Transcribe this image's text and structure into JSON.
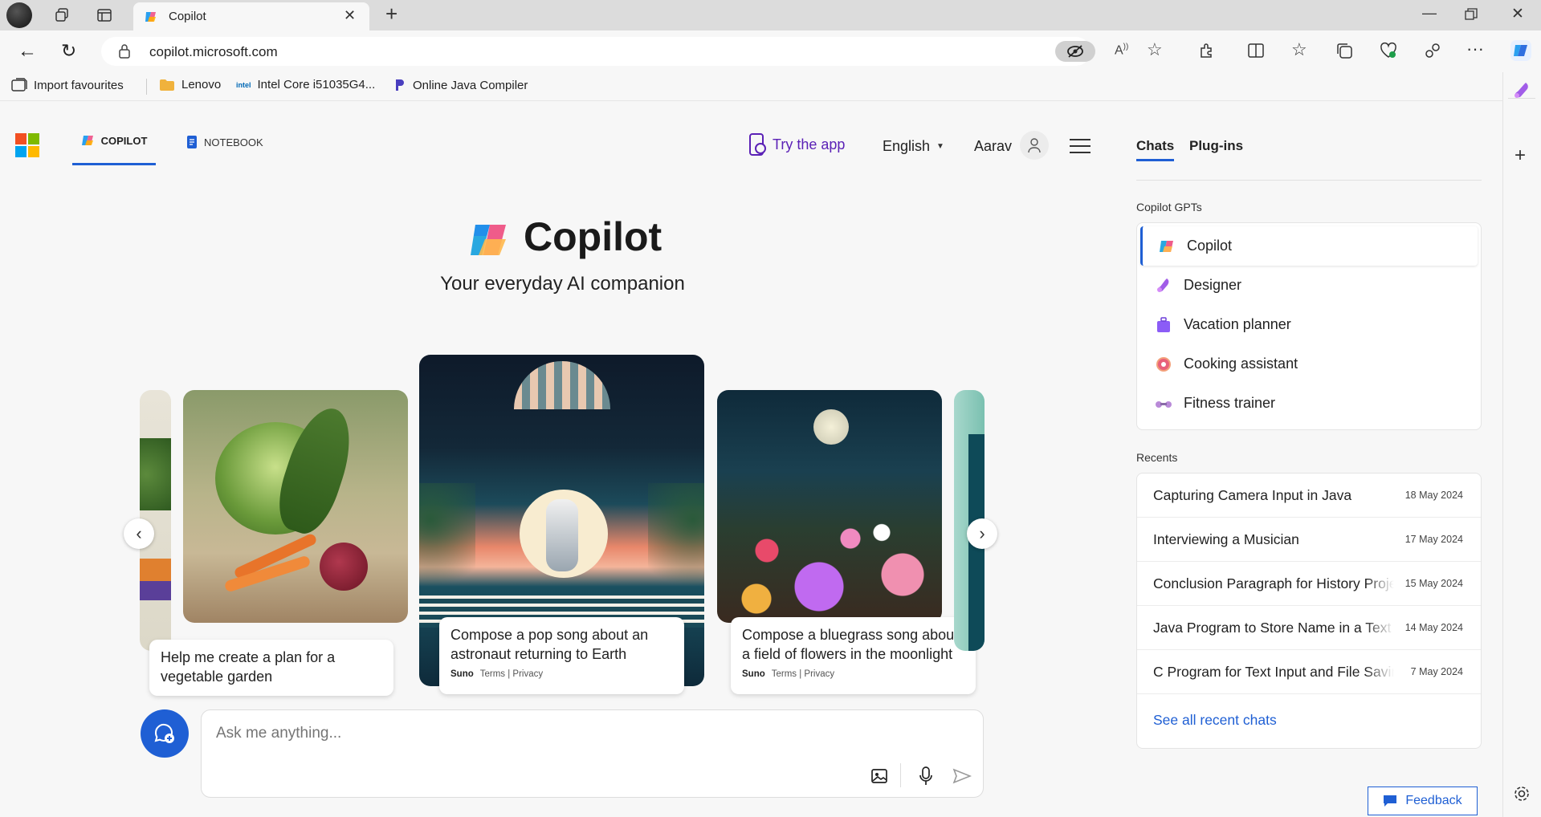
{
  "browser": {
    "tab_title": "Copilot",
    "url": "copilot.microsoft.com",
    "favourites": [
      {
        "label": "Import favourites"
      },
      {
        "label": "Lenovo"
      },
      {
        "label": "Intel Core i51035G4..."
      },
      {
        "label": "Online Java Compiler"
      }
    ],
    "intel_mark": "intel"
  },
  "header": {
    "tabs": [
      {
        "label": "COPILOT",
        "active": true
      },
      {
        "label": "NOTEBOOK",
        "active": false
      }
    ],
    "try_app": "Try the app",
    "language": "English",
    "user_name": "Aarav"
  },
  "hero": {
    "title": "Copilot",
    "subtitle": "Your everyday AI companion"
  },
  "carousel": {
    "cards": [
      {
        "text": "Help me create a plan for a vegetable garden"
      },
      {
        "text": "Compose a pop song about an astronaut returning to Earth",
        "brand": "Suno",
        "links": "Terms | Privacy"
      },
      {
        "text": "Compose a bluegrass song about a field of flowers in the moonlight",
        "brand": "Suno",
        "links": "Terms | Privacy"
      }
    ]
  },
  "composer": {
    "placeholder": "Ask me anything..."
  },
  "panel": {
    "tabs": [
      {
        "label": "Chats",
        "active": true
      },
      {
        "label": "Plug-ins",
        "active": false
      }
    ],
    "gpts_heading": "Copilot GPTs",
    "gpts": [
      {
        "label": "Copilot",
        "icon": "copilot-icon",
        "active": true
      },
      {
        "label": "Designer",
        "icon": "designer-icon"
      },
      {
        "label": "Vacation planner",
        "icon": "suitcase-icon"
      },
      {
        "label": "Cooking assistant",
        "icon": "donut-icon"
      },
      {
        "label": "Fitness trainer",
        "icon": "dumbbell-icon"
      }
    ],
    "recents_heading": "Recents",
    "recents": [
      {
        "title": "Capturing Camera Input in Java",
        "date": "18 May 2024"
      },
      {
        "title": "Interviewing a Musician",
        "date": "17 May 2024"
      },
      {
        "title": "Conclusion Paragraph for History Project",
        "date": "15 May 2024"
      },
      {
        "title": "Java Program to Store Name in a Text File",
        "date": "14 May 2024"
      },
      {
        "title": "C Program for Text Input and File Saving",
        "date": "7 May 2024"
      }
    ],
    "see_all": "See all recent chats",
    "feedback": "Feedback"
  },
  "colors": {
    "accent": "#1f5fd4",
    "link": "#1f5fd4",
    "try_app": "#5b21b6"
  }
}
